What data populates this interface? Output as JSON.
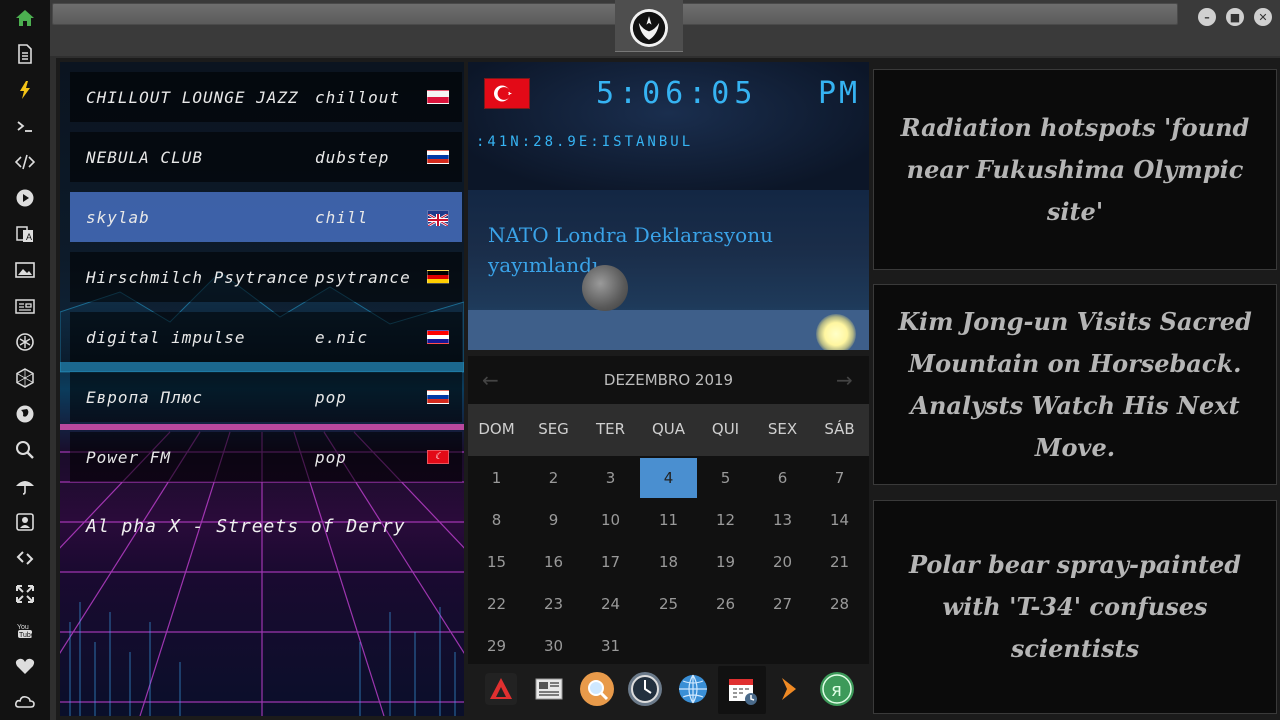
{
  "sidebar": {
    "icons": [
      "home-icon",
      "document-icon",
      "lightning-icon",
      "terminal-icon",
      "code-icon",
      "play-icon",
      "translate-icon",
      "image-icon",
      "news-icon",
      "rebel-icon",
      "hexagon-icon",
      "globe-icon",
      "search-icon",
      "umbrella-icon",
      "contact-icon",
      "link-icon",
      "expand-icon",
      "youtube-icon",
      "heart-icon",
      "cloud-icon"
    ]
  },
  "window": {
    "minimize": "–",
    "maximize": "■",
    "close": "✕"
  },
  "radio": {
    "stations": [
      {
        "name": "CHILLOUT LOUNGE JAZZ",
        "genre": "chillout",
        "flag": "poland"
      },
      {
        "name": "NEBULA CLUB",
        "genre": "dubstep",
        "flag": "russia"
      },
      {
        "name": "skylab",
        "genre": "chill",
        "flag": "uk"
      },
      {
        "name": "Hirschmilch Psytrance",
        "genre": "psytrance",
        "flag": "germany"
      },
      {
        "name": "digital impulse",
        "genre": "e.nic",
        "flag": "croatia"
      },
      {
        "name": "Европа Плюс",
        "genre": "pop",
        "flag": "russia"
      },
      {
        "name": "Power FM",
        "genre": "pop",
        "flag": "turkey"
      }
    ],
    "active_index": 2,
    "now_playing": "Al pha X - Streets of Derry"
  },
  "clock": {
    "time": "5:06:05",
    "ampm": "PM",
    "location": ":41N:28.9E:ISTANBUL",
    "headline": "NATO Londra Deklarasyonu yayımlandı"
  },
  "calendar": {
    "month_label": "DEZEMBRO 2019",
    "prev": "←",
    "next": "→",
    "weekdays": [
      "DOM",
      "SEG",
      "TER",
      "QUA",
      "QUI",
      "SEX",
      "SÁB"
    ],
    "weeks": [
      [
        "1",
        "2",
        "3",
        "4",
        "5",
        "6",
        "7"
      ],
      [
        "8",
        "9",
        "10",
        "11",
        "12",
        "13",
        "14"
      ],
      [
        "15",
        "16",
        "17",
        "18",
        "19",
        "20",
        "21"
      ],
      [
        "22",
        "23",
        "24",
        "25",
        "26",
        "27",
        "28"
      ],
      [
        "29",
        "30",
        "31",
        "",
        "",
        "",
        ""
      ]
    ],
    "today": "4"
  },
  "dock": {
    "items": [
      "app-launcher-icon",
      "news-reader-icon",
      "search-app-icon",
      "clock-app-icon",
      "browser-icon",
      "calendar-app-icon",
      "forward-icon",
      "yandex-icon"
    ]
  },
  "news": [
    "Radiation hotspots 'found near Fukushima Olympic site'",
    "Kim Jong-un Visits Sacred Mountain on Horseback. Analysts Watch His Next Move.",
    "Polar bear spray-painted with 'T-34' confuses scientists"
  ]
}
